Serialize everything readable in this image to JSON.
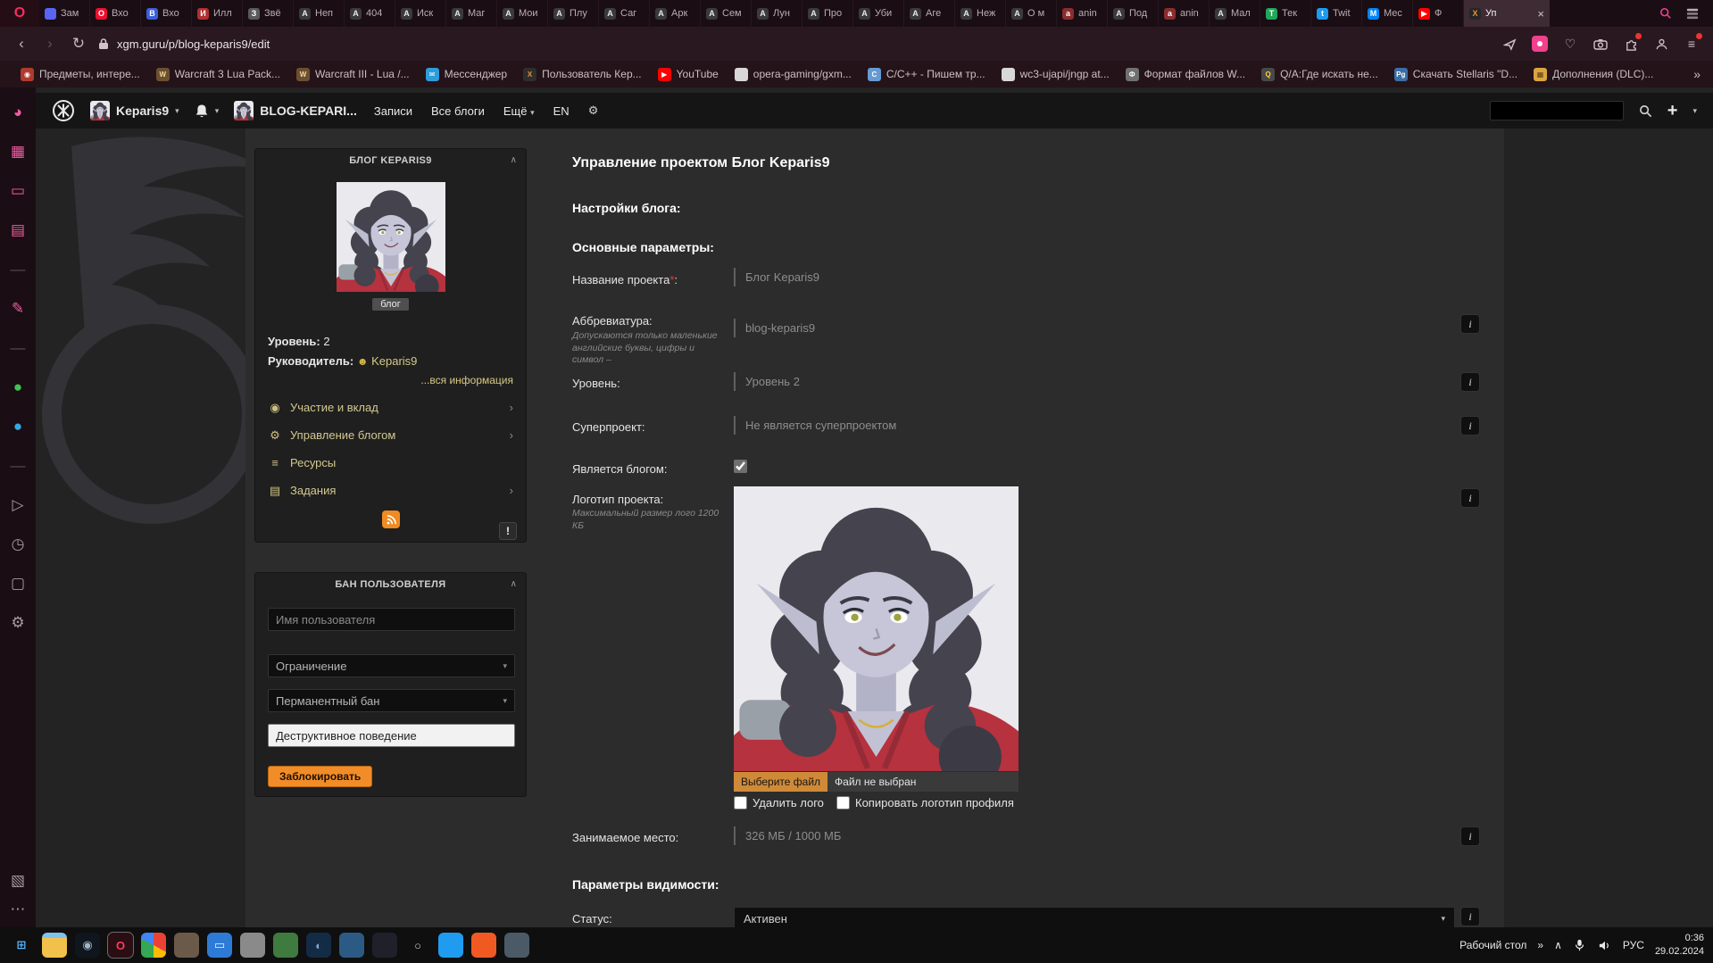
{
  "browser": {
    "menu_button": "O",
    "tabs": [
      {
        "label": "Зам",
        "fav_char": "",
        "fav_bg": "#5865f2",
        "fav_fg": "#ffffff"
      },
      {
        "label": "Вхо",
        "fav_char": "O",
        "fav_bg": "#e8112d",
        "fav_fg": "#ffffff"
      },
      {
        "label": "Вхо",
        "fav_char": "B",
        "fav_bg": "#3b5fd9",
        "fav_fg": "#ffffff"
      },
      {
        "label": "Илл",
        "fav_char": "И",
        "fav_bg": "#b03030",
        "fav_fg": "#ffffff"
      },
      {
        "label": "Звё",
        "fav_char": "З",
        "fav_bg": "#5a5a5a",
        "fav_fg": "#ffffff"
      },
      {
        "label": "Неп",
        "fav_char": "А",
        "fav_bg": "#3a3a3a",
        "fav_fg": "#e8e8e8"
      },
      {
        "label": "404",
        "fav_char": "А",
        "fav_bg": "#3a3a3a",
        "fav_fg": "#e8e8e8"
      },
      {
        "label": "Иск",
        "fav_char": "А",
        "fav_bg": "#3a3a3a",
        "fav_fg": "#e8e8e8"
      },
      {
        "label": "Маг",
        "fav_char": "А",
        "fav_bg": "#3a3a3a",
        "fav_fg": "#e8e8e8"
      },
      {
        "label": "Мои",
        "fav_char": "А",
        "fav_bg": "#3a3a3a",
        "fav_fg": "#e8e8e8"
      },
      {
        "label": "Плу",
        "fav_char": "А",
        "fav_bg": "#3a3a3a",
        "fav_fg": "#e8e8e8"
      },
      {
        "label": "Саг",
        "fav_char": "А",
        "fav_bg": "#3a3a3a",
        "fav_fg": "#e8e8e8"
      },
      {
        "label": "Арк",
        "fav_char": "А",
        "fav_bg": "#3a3a3a",
        "fav_fg": "#e8e8e8"
      },
      {
        "label": "Сем",
        "fav_char": "А",
        "fav_bg": "#3a3a3a",
        "fav_fg": "#e8e8e8"
      },
      {
        "label": "Лун",
        "fav_char": "А",
        "fav_bg": "#3a3a3a",
        "fav_fg": "#e8e8e8"
      },
      {
        "label": "Про",
        "fav_char": "А",
        "fav_bg": "#3a3a3a",
        "fav_fg": "#e8e8e8"
      },
      {
        "label": "Уби",
        "fav_char": "А",
        "fav_bg": "#3a3a3a",
        "fav_fg": "#e8e8e8"
      },
      {
        "label": "Аге",
        "fav_char": "А",
        "fav_bg": "#3a3a3a",
        "fav_fg": "#e8e8e8"
      },
      {
        "label": "Неж",
        "fav_char": "А",
        "fav_bg": "#3a3a3a",
        "fav_fg": "#e8e8e8"
      },
      {
        "label": "О м",
        "fav_char": "А",
        "fav_bg": "#3a3a3a",
        "fav_fg": "#e8e8e8"
      },
      {
        "label": "anin",
        "fav_char": "a",
        "fav_bg": "#8a2d2d",
        "fav_fg": "#ffffff"
      },
      {
        "label": "Под",
        "fav_char": "А",
        "fav_bg": "#3a3a3a",
        "fav_fg": "#e8e8e8"
      },
      {
        "label": "anin",
        "fav_char": "a",
        "fav_bg": "#8a2d2d",
        "fav_fg": "#ffffff"
      },
      {
        "label": "Мал",
        "fav_char": "А",
        "fav_bg": "#3a3a3a",
        "fav_fg": "#e8e8e8"
      },
      {
        "label": "Тек",
        "fav_char": "T",
        "fav_bg": "#21a65a",
        "fav_fg": "#ffffff"
      },
      {
        "label": "Twit",
        "fav_char": "t",
        "fav_bg": "#1d9bf0",
        "fav_fg": "#ffffff"
      },
      {
        "label": "Мес",
        "fav_char": "M",
        "fav_bg": "#0084ff",
        "fav_fg": "#ffffff"
      },
      {
        "label": "Ф",
        "fav_char": "▶",
        "fav_bg": "#ff0000",
        "fav_fg": "#ffffff"
      }
    ],
    "active_tab": {
      "label": "Уп",
      "fav_char": "X",
      "fav_bg": "#262626",
      "fav_fg": "#e8913a",
      "close": "×"
    },
    "nav": {
      "back": "‹",
      "forward": "›",
      "reload": "↻"
    },
    "address": {
      "url": "xgm.guru/p/blog-keparis9/edit"
    },
    "bookmarks": [
      {
        "label": "Предметы, интере...",
        "char": "◉",
        "bg": "#b03a2e",
        "fg": "#ffffff"
      },
      {
        "label": "Warcraft 3 Lua Pack...",
        "char": "W",
        "bg": "#6b4f2f",
        "fg": "#f0d9a0"
      },
      {
        "label": "Warcraft III - Lua /...",
        "char": "W",
        "bg": "#6b4f2f",
        "fg": "#f0d9a0"
      },
      {
        "label": "Мессенджер",
        "char": "✉",
        "bg": "#2d9cdb",
        "fg": "#ffffff"
      },
      {
        "label": "Пользователь Кер...",
        "char": "X",
        "bg": "#2e2e2e",
        "fg": "#e8913a"
      },
      {
        "label": "YouTube",
        "char": "▶",
        "bg": "#ff0000",
        "fg": "#ffffff"
      },
      {
        "label": "opera-gaming/gxm...",
        "char": "",
        "bg": "#d7d7d7",
        "fg": "#111111"
      },
      {
        "label": "C/C++ - Пишем тр...",
        "char": "C",
        "bg": "#659ad2",
        "fg": "#ffffff"
      },
      {
        "label": "wc3-ujapi/jngp at...",
        "char": "",
        "bg": "#d7d7d7",
        "fg": "#111111"
      },
      {
        "label": "Формат файлов W...",
        "char": "Ф",
        "bg": "#707070",
        "fg": "#ffffff"
      },
      {
        "label": "Q/A:Где искать не...",
        "char": "Q",
        "bg": "#484848",
        "fg": "#ffd23e"
      },
      {
        "label": "Скачать Stellaris \"D...",
        "char": "Pg",
        "bg": "#3b6ea5",
        "fg": "#ffffff"
      },
      {
        "label": "Дополнения (DLC)...",
        "char": "▦",
        "bg": "#d9a441",
        "fg": "#5b3c10"
      }
    ],
    "bookmarks_more": "»"
  },
  "gx_sidebar": {
    "icons": [
      {
        "name": "gx-home-icon",
        "char": "◕",
        "color": "#ef5da2"
      },
      {
        "name": "gx-mods-icon",
        "char": "▦",
        "color": "#ef5da2"
      },
      {
        "name": "chat-icon",
        "char": "▭",
        "color": "#ef5da2"
      },
      {
        "name": "calendar-icon",
        "char": "▤",
        "color": "#ef5da2"
      },
      {
        "name": "divider",
        "char": "—",
        "color": "#5c4a52"
      },
      {
        "name": "design-icon",
        "char": "✎",
        "color": "#ef5da2"
      },
      {
        "name": "divider",
        "char": "—",
        "color": "#5c4a52"
      },
      {
        "name": "whatsapp-icon",
        "char": "●",
        "color": "#3fc351"
      },
      {
        "name": "telegram-icon",
        "char": "●",
        "color": "#35a9e0"
      },
      {
        "name": "divider",
        "char": "—",
        "color": "#5c4a52"
      },
      {
        "name": "player-icon",
        "char": "▷",
        "color": "#a89ba1"
      },
      {
        "name": "history-icon",
        "char": "◷",
        "color": "#a89ba1"
      },
      {
        "name": "box-icon",
        "char": "▢",
        "color": "#a89ba1"
      },
      {
        "name": "settings-icon",
        "char": "⚙",
        "color": "#a89ba1"
      }
    ],
    "bottom": {
      "panels_char": "▧",
      "more_char": "⋯"
    }
  },
  "site": {
    "header": {
      "user_name": "Keparis9",
      "blog_name": "BLOG-KEPARI...",
      "nav": [
        {
          "label": "Записи",
          "chevron": ""
        },
        {
          "label": "Все блоги",
          "chevron": ""
        },
        {
          "label": "Ещё",
          "chevron": "▾"
        }
      ],
      "lang": "EN",
      "add_button": "+"
    },
    "blog_panel": {
      "title": "БЛОГ KEPARIS9",
      "collapse": "∧",
      "badge": "блог",
      "level_label": "Уровень:",
      "level_value": "2",
      "owner_label": "Руководитель:",
      "owner_icon": "☻",
      "owner_value": "Keparis9",
      "all_info_link": "...вся информация",
      "menu": [
        {
          "icon": "◉",
          "label": "Участие и вклад",
          "chevron": "›"
        },
        {
          "icon": "⚙",
          "label": "Управление блогом",
          "chevron": "›"
        },
        {
          "icon": "≡",
          "label": "Ресурсы",
          "chevron": ""
        },
        {
          "icon": "▤",
          "label": "Задания",
          "chevron": "›"
        }
      ],
      "alert_button": "!"
    },
    "ban_panel": {
      "title": "БАН ПОЛЬЗОВАТЕЛЯ",
      "collapse": "∧",
      "username_placeholder": "Имя пользователя",
      "restriction_select": "Ограничение",
      "duration_select": "Перманентный бан",
      "reason_value": "Деструктивное поведение",
      "submit": "Заблокировать",
      "select_chevron": "▾"
    },
    "form": {
      "page_title": "Управление проектом Блог Keparis9",
      "settings_heading": "Настройки блога:",
      "base_params_heading": "Основные параметры:",
      "info_icon": "i",
      "name": {
        "label": "Название проекта",
        "required_mark": "*",
        "colon": ":",
        "value": "Блог Keparis9"
      },
      "abbr": {
        "label": "Аббревиатура:",
        "hint": "Допускаются только маленькие английские буквы, цифры и символ –",
        "value": "blog-keparis9"
      },
      "level": {
        "label": "Уровень:",
        "value": "Уровень 2"
      },
      "superproject": {
        "label": "Суперпроект:",
        "value": "Не является суперпроектом"
      },
      "is_blog": {
        "label": "Является блогом:"
      },
      "logo": {
        "label": "Логотип проекта:",
        "hint": "Максимальный размер лого 1200 КБ",
        "choose_file": "Выберите файл",
        "no_file": "Файл не выбран",
        "delete_logo": "Удалить лого",
        "copy_logo": "Копировать логотип профиля"
      },
      "space": {
        "label": "Занимаемое место:",
        "value": "326 МБ / 1000 МБ"
      },
      "visibility_heading": "Параметры видимости:",
      "status": {
        "label": "Статус:",
        "value": "Активен",
        "chevron": "▾"
      }
    }
  },
  "taskbar": {
    "apps": [
      {
        "name": "start-button",
        "char": "⊞",
        "bg": "transparent",
        "fg": "#57b8ff"
      },
      {
        "name": "file-explorer",
        "char": "",
        "bg": "linear-gradient(180deg,#7ec3f0 22%,#f2c14b 22%)",
        "fg": "#fff"
      },
      {
        "name": "steam",
        "char": "◉",
        "bg": "#10161d",
        "fg": "#9fb6c9"
      },
      {
        "name": "opera-gx",
        "char": "O",
        "bg": "#2b0d14",
        "fg": "#fa3c5f",
        "outline": "1px solid #6b6b6b"
      },
      {
        "name": "chrome",
        "char": "",
        "bg": "conic-gradient(#ea4335 0 33%,#fbbc05 33% 50%,#34a853 50% 83%,#4285f4 83% 100%)",
        "fg": "#fff"
      },
      {
        "name": "gimp",
        "char": "",
        "bg": "#6b5a4a",
        "fg": "#fff"
      },
      {
        "name": "remote-desktop",
        "char": "▭",
        "bg": "#2e7bd6",
        "fg": "#dff6ff"
      },
      {
        "name": "gray-app",
        "char": "",
        "bg": "#8a8a8a",
        "fg": "#fff"
      },
      {
        "name": "green-app",
        "char": "",
        "bg": "#3f7a3f",
        "fg": "#fff"
      },
      {
        "name": "dark-sphere-app",
        "char": "◐",
        "bg": "#132b45",
        "fg": "#7fa7c9"
      },
      {
        "name": "python-app",
        "char": "",
        "bg": "#2b5b84",
        "fg": "#ffd94a"
      },
      {
        "name": "dark-app",
        "char": "",
        "bg": "#20202a",
        "fg": "#888"
      },
      {
        "name": "ring-app",
        "char": "○",
        "bg": "transparent",
        "fg": "#cfcfcf"
      },
      {
        "name": "vscode",
        "char": "",
        "bg": "#1f9cf0",
        "fg": "#fff"
      },
      {
        "name": "orange-app",
        "char": "",
        "bg": "#f05a22",
        "fg": "#fff"
      },
      {
        "name": "steel-app",
        "char": "",
        "bg": "#4a5a66",
        "fg": "#fff"
      }
    ],
    "desktop_label": "Рабочий стол",
    "more": "»",
    "hidden_icons": "∧",
    "lang": "РУС",
    "time": "0:36",
    "date": "29.02.2024"
  }
}
